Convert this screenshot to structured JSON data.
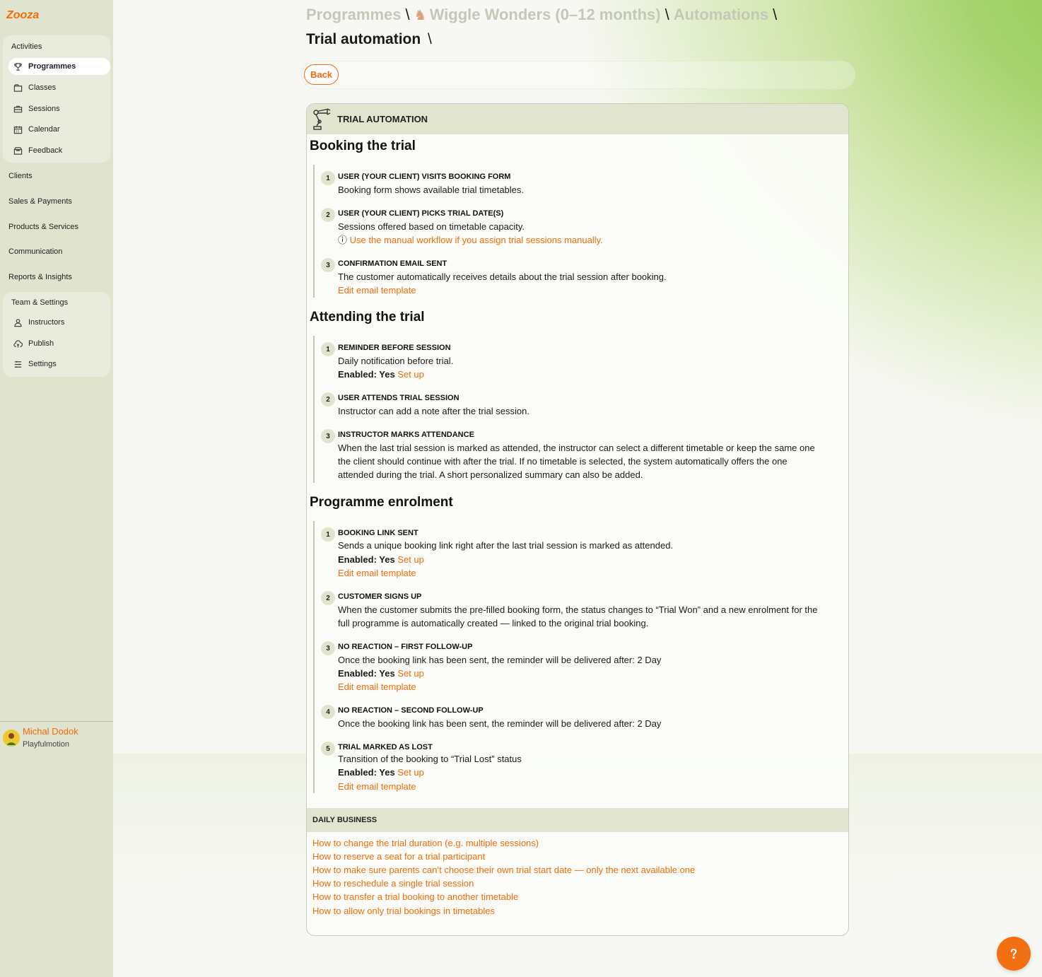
{
  "brand": {
    "logo_text": "Zooza",
    "accent": "#f06c0a"
  },
  "sidebar": {
    "activities_label": "Activities",
    "activities_items": [
      {
        "label": "Programmes",
        "icon": "trophy-icon",
        "active": true
      },
      {
        "label": "Classes",
        "icon": "folder-icon"
      },
      {
        "label": "Sessions",
        "icon": "briefcase-icon"
      },
      {
        "label": "Calendar",
        "icon": "calendar-icon"
      },
      {
        "label": "Feedback",
        "icon": "inbox-icon"
      }
    ],
    "top_items": [
      "Clients",
      "Sales & Payments",
      "Products & Services",
      "Communication",
      "Reports & Insights"
    ],
    "team_label": "Team & Settings",
    "team_items": [
      {
        "label": "Instructors",
        "icon": "user-icon"
      },
      {
        "label": "Publish",
        "icon": "cloud-upload-icon"
      },
      {
        "label": "Settings",
        "icon": "settings-icon"
      }
    ],
    "user": {
      "name": "Michal Dodok",
      "org": "Playfulmotion"
    }
  },
  "breadcrumb": {
    "programmes": "Programmes",
    "programme": "Wiggle Wonders (0–12 months)",
    "automations": "Automations",
    "sep": "\\"
  },
  "page_title": "Trial automation",
  "page_title_sep": "\\",
  "back_label": "Back",
  "card": {
    "title": "TRIAL AUTOMATION",
    "sections": {
      "booking": {
        "title": "Booking the trial",
        "s1": {
          "num": "1",
          "title": "USER (YOUR CLIENT) VISITS BOOKING FORM",
          "text": "Booking form shows available trial timetables."
        },
        "s2": {
          "num": "2",
          "title": "USER (YOUR CLIENT) PICKS TRIAL DATE(S)",
          "text": "Sessions offered based on timetable capacity.",
          "info_icon": "ⓘ",
          "info": "Use the manual workflow if you assign trial sessions manually."
        },
        "s3": {
          "num": "3",
          "title": "CONFIRMATION EMAIL SENT",
          "text": "The customer automatically receives details about the trial session after booking.",
          "link": "Edit email template"
        }
      },
      "attending": {
        "title": "Attending the trial",
        "s1": {
          "num": "1",
          "title": "REMINDER BEFORE SESSION",
          "text": "Daily notification before trial.",
          "enabled_label": "Enabled: Yes",
          "setup": "Set up"
        },
        "s2": {
          "num": "2",
          "title": "USER ATTENDS TRIAL SESSION",
          "text": "Instructor can add a note after the trial session."
        },
        "s3": {
          "num": "3",
          "title": "INSTRUCTOR MARKS ATTENDANCE",
          "line1": "When the last trial session is marked as attended, the instructor can select a different timetable or keep the same one",
          "line2": "the client should continue with after the trial. If no timetable is selected, the system automatically offers the one",
          "line3": "attended during the trial. A short personalized summary can also be added."
        }
      },
      "enrolment": {
        "title": "Programme enrolment",
        "s1": {
          "num": "1",
          "title": "BOOKING LINK SENT",
          "text": "Sends a unique booking link right after the last trial session is marked as attended.",
          "enabled_label": "Enabled: Yes",
          "setup": "Set up",
          "link": "Edit email template"
        },
        "s2": {
          "num": "2",
          "title": "CUSTOMER SIGNS UP",
          "line1": "When the customer submits the pre-filled booking form, the status changes to “Trial Won” and a new enrolment for the",
          "line2": "full programme is automatically created — linked to the original trial booking."
        },
        "s3": {
          "num": "3",
          "title": "NO REACTION – FIRST FOLLOW-UP",
          "text": "Once the booking link has been sent, the reminder will be delivered after: 2 Day",
          "enabled_label": "Enabled: Yes",
          "setup": "Set up",
          "link": "Edit email template"
        },
        "s4": {
          "num": "4",
          "title": "NO REACTION – SECOND FOLLOW-UP",
          "text": "Once the booking link has been sent, the reminder will be delivered after: 2 Day"
        },
        "s5": {
          "num": "5",
          "title": "TRIAL MARKED AS LOST",
          "text": "Transition of the booking to “Trial Lost” status",
          "enabled_label": "Enabled: Yes",
          "setup": "Set up",
          "link": "Edit email template"
        }
      }
    },
    "daily": {
      "title": "DAILY BUSINESS",
      "links": [
        "How to change the trial duration (e.g. multiple sessions)",
        "How to reserve a seat for a trial participant",
        "How to make sure parents can’t choose their own trial start date — only the next available one",
        "How to reschedule a single trial session",
        "How to transfer a trial booking to another timetable",
        "How to allow only trial bookings in timetables"
      ]
    }
  },
  "help_icon": "question-icon"
}
